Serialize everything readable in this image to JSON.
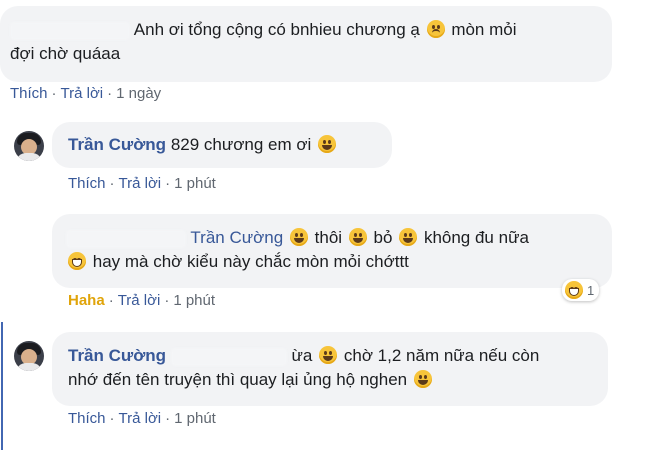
{
  "comments": [
    {
      "author": "",
      "text": "Anh ơi tổng cộng có bnhieu chương ạ",
      "text2": "mòn mỏi",
      "text_line2": "đợi chờ quáaa",
      "emoji": "sad-face-icon",
      "actions": {
        "like": "Thích",
        "reply": "Trả lời",
        "time": "1 ngày"
      }
    },
    {
      "author": "Trần Cường",
      "text": "829 chương em ơi",
      "emoji": "smile-icon",
      "actions": {
        "like": "Thích",
        "reply": "Trả lời",
        "time": "1 phút"
      }
    },
    {
      "author": "",
      "mention": "Trần Cường",
      "seg1": "thôi",
      "seg2": "bỏ",
      "seg3": "không đu nữa",
      "line2": "hay mà chờ kiểu này chắc mòn mỏi chớttt",
      "actions": {
        "like": "Haha",
        "reply": "Trả lời",
        "time": "1 phút"
      },
      "reaction_count": "1"
    },
    {
      "author": "Trần Cường",
      "text_a": "ừa",
      "text_b": "chờ 1,2 năm nữa nếu còn",
      "line2": "nhớ đến tên truyện thì quay lại ủng hộ nghen",
      "actions": {
        "like": "Thích",
        "reply": "Trả lời",
        "time": "1 phút"
      }
    }
  ],
  "separator": "·",
  "colors": {
    "link": "#385898",
    "haha": "#e0a40a",
    "bubble": "#f2f3f5",
    "thread": "#4267b2"
  }
}
